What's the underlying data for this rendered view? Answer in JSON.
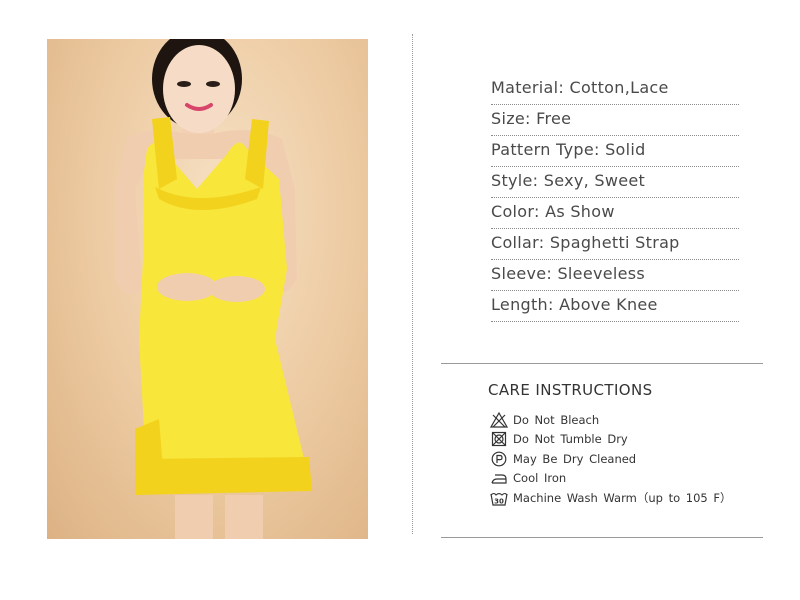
{
  "product_photo": {
    "alt": "Model wearing yellow sleeveless lace-trim dress",
    "dress_color": "#f8e63a",
    "lace_color": "#f3d21d"
  },
  "specifications": [
    {
      "label": "Material",
      "value": "Cotton,Lace",
      "text": "Material: Cotton,Lace"
    },
    {
      "label": "Size",
      "value": "Free",
      "text": "Size: Free"
    },
    {
      "label": "Pattern Type",
      "value": "Solid",
      "text": "Pattern Type: Solid"
    },
    {
      "label": "Style",
      "value": "Sexy, Sweet",
      "text": "Style: Sexy, Sweet"
    },
    {
      "label": "Color",
      "value": "As Show",
      "text": "Color: As Show"
    },
    {
      "label": "Collar",
      "value": "Spaghetti Strap",
      "text": "Collar: Spaghetti Strap"
    },
    {
      "label": "Sleeve",
      "value": "Sleeveless",
      "text": "Sleeve: Sleeveless"
    },
    {
      "label": "Length",
      "value": "Above Knee",
      "text": "Length: Above Knee"
    }
  ],
  "care": {
    "title": "CARE  INSTRUCTIONS",
    "items": [
      {
        "icon": "do-not-bleach-icon",
        "text": "Do  Not  Bleach"
      },
      {
        "icon": "do-not-tumble-dry-icon",
        "text": "Do  Not  Tumble  Dry"
      },
      {
        "icon": "dry-clean-p-icon",
        "text": "May  Be  Dry  Cleaned"
      },
      {
        "icon": "cool-iron-icon",
        "text": "Cool  Iron"
      },
      {
        "icon": "machine-wash-30-icon",
        "text": "Machine  Wash  Warm（up  to  105  F）"
      }
    ],
    "wash_icon_label": "30"
  }
}
